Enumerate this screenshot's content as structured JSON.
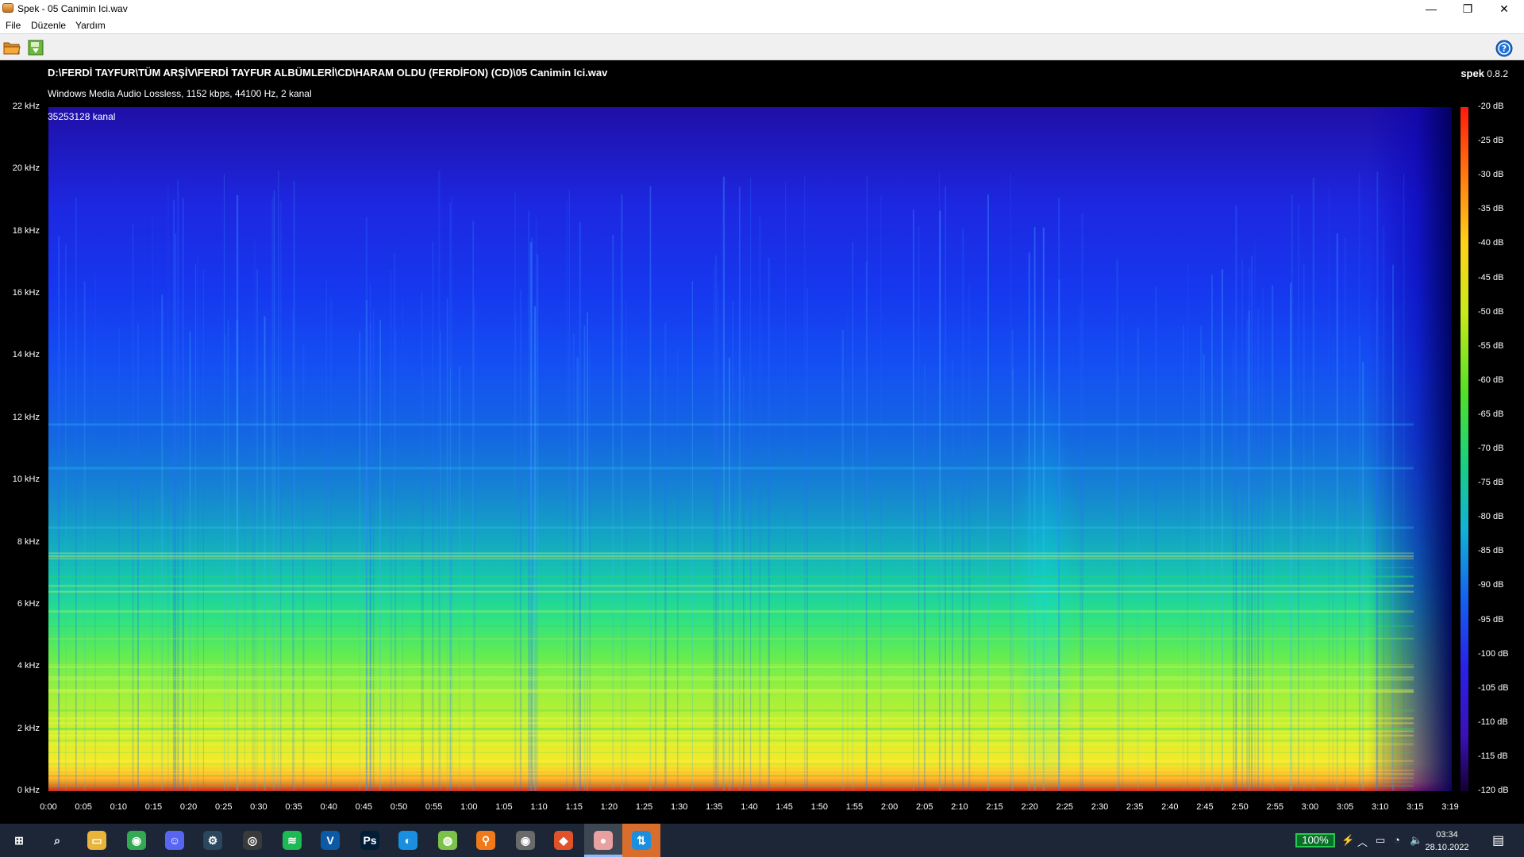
{
  "window": {
    "title": "Spek - 05 Canimin Ici.wav",
    "icon": "spek-icon"
  },
  "menu": [
    "File",
    "Düzenle",
    "Yardım"
  ],
  "toolbar": {
    "open_icon": "folder-open-icon",
    "save_icon": "save-image-icon",
    "help_icon": "help-icon"
  },
  "header": {
    "file_path": "D:\\FERDİ TAYFUR\\TÜM ARŞİV\\FERDİ TAYFUR ALBÜMLERİ\\CD\\HARAM OLDU (FERDİFON) (CD)\\05 Canimin Ici.wav",
    "file_info": "Windows Media Audio Lossless, 1152 kbps, 44100 Hz, 2 kanal",
    "app_name": "spek",
    "app_version": "0.8.2"
  },
  "spectrogram": {
    "overlay_label": "35253128 kanal",
    "y_ticks": [
      "22 kHz",
      "20 kHz",
      "18 kHz",
      "16 kHz",
      "14 kHz",
      "12 kHz",
      "10 kHz",
      "8 kHz",
      "6 kHz",
      "4 kHz",
      "2 kHz",
      "0 kHz"
    ],
    "x_ticks": [
      "0:00",
      "0:05",
      "0:10",
      "0:15",
      "0:20",
      "0:25",
      "0:30",
      "0:35",
      "0:40",
      "0:45",
      "0:50",
      "0:55",
      "1:00",
      "1:05",
      "1:10",
      "1:15",
      "1:20",
      "1:25",
      "1:30",
      "1:35",
      "1:40",
      "1:45",
      "1:50",
      "1:55",
      "2:00",
      "2:05",
      "2:10",
      "2:15",
      "2:20",
      "2:25",
      "2:30",
      "2:35",
      "2:40",
      "2:45",
      "2:50",
      "2:55",
      "3:00",
      "3:05",
      "3:10",
      "3:15",
      "3:19"
    ],
    "db_ticks": [
      "-20 dB",
      "-25 dB",
      "-30 dB",
      "-35 dB",
      "-40 dB",
      "-45 dB",
      "-50 dB",
      "-55 dB",
      "-60 dB",
      "-65 dB",
      "-70 dB",
      "-75 dB",
      "-80 dB",
      "-85 dB",
      "-90 dB",
      "-95 dB",
      "-100 dB",
      "-105 dB",
      "-110 dB",
      "-115 dB",
      "-120 dB"
    ],
    "colors": {
      "high": "#d42b1a",
      "mid": "#62ec52",
      "low": "#1f0fa6"
    }
  },
  "taskbar": {
    "apps": [
      {
        "name": "windows-start-icon",
        "glyph": "⊞",
        "color": "#1c2636"
      },
      {
        "name": "search-icon",
        "glyph": "⌕",
        "color": "#1c2636"
      },
      {
        "name": "file-explorer-icon",
        "glyph": "▭",
        "color": "#e8b43a"
      },
      {
        "name": "chrome-icon",
        "glyph": "◉",
        "color": "#34a853"
      },
      {
        "name": "discord-icon",
        "glyph": "☺",
        "color": "#5865f2"
      },
      {
        "name": "steam-icon",
        "glyph": "⚙",
        "color": "#2a475e"
      },
      {
        "name": "obs-icon",
        "glyph": "◎",
        "color": "#3a3a3a"
      },
      {
        "name": "spotify-icon",
        "glyph": "≋",
        "color": "#1db954"
      },
      {
        "name": "vegas-icon",
        "glyph": "V",
        "color": "#0c5aa6"
      },
      {
        "name": "photoshop-icon",
        "glyph": "Ps",
        "color": "#001e36"
      },
      {
        "name": "app-blue-icon",
        "glyph": "◐",
        "color": "#1a8fe0"
      },
      {
        "name": "app-green-icon",
        "glyph": "◍",
        "color": "#7cc24a"
      },
      {
        "name": "search-tool-icon",
        "glyph": "⚲",
        "color": "#f07a1a"
      },
      {
        "name": "media-player-icon",
        "glyph": "◉",
        "color": "#6a6a6a"
      },
      {
        "name": "app-diamond-icon",
        "glyph": "◆",
        "color": "#e0532a"
      },
      {
        "name": "spek-taskbar-icon",
        "glyph": "●",
        "color": "#e8a0a0"
      },
      {
        "name": "app-arrow-icon",
        "glyph": "⇅",
        "color": "#1a8fe0"
      }
    ],
    "battery": "100%",
    "time": "03:34",
    "date": "28.10.2022"
  }
}
